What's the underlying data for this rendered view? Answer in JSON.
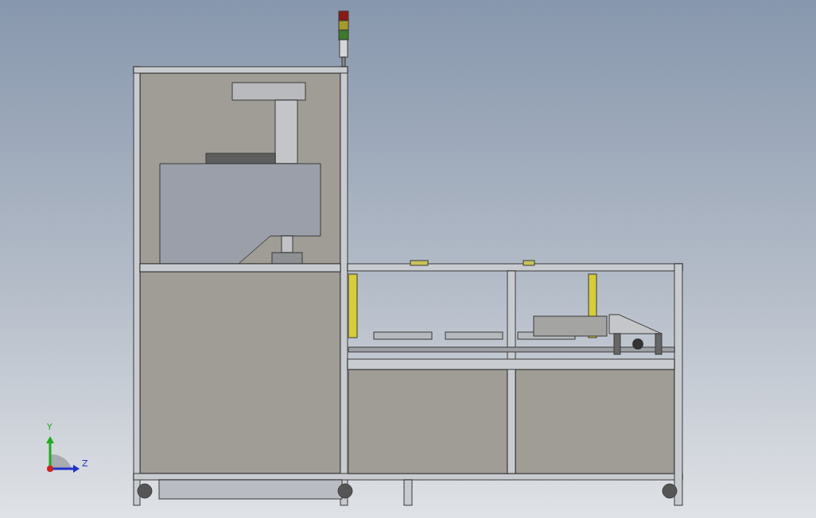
{
  "viewport": {
    "triad": {
      "labels": [
        "Y",
        "Z"
      ]
    }
  }
}
